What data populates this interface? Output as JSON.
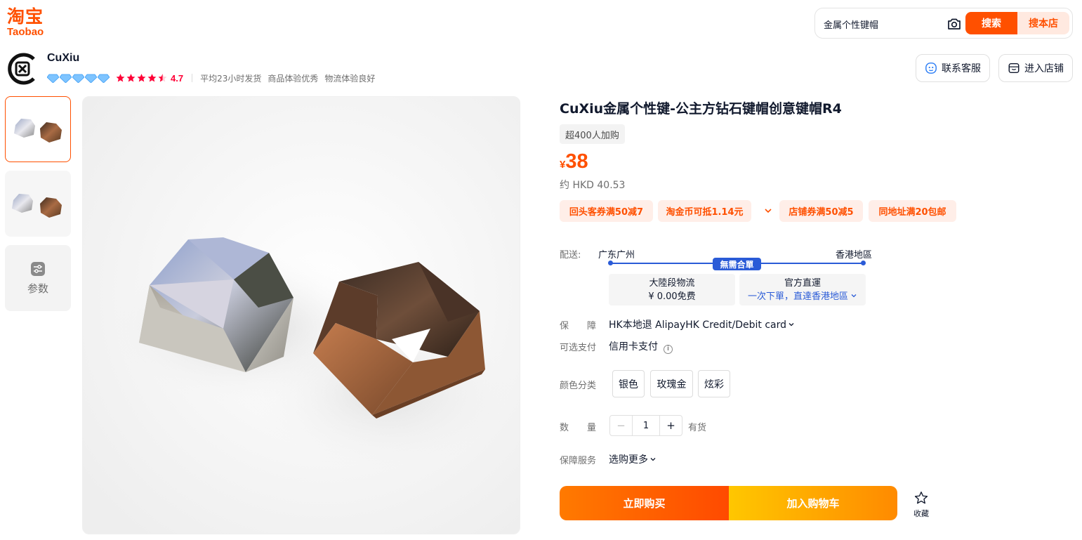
{
  "brand": {
    "logo_cn": "淘宝",
    "logo_en": "Taobao",
    "color": "#ff5000"
  },
  "search": {
    "query": "金属个性键帽",
    "search_label": "搜索",
    "store_search_label": "搜本店"
  },
  "shop": {
    "name": "CuXiu",
    "diamonds": 5,
    "stars": 4.7,
    "rating": "4.7",
    "tags": [
      "平均23小时发货",
      "商品体验优秀",
      "物流体验良好"
    ],
    "contact_label": "联系客服",
    "enter_store_label": "进入店铺"
  },
  "gallery": {
    "params_label": "参数",
    "thumbnails": 2
  },
  "product": {
    "title": "CuXiu金属个性键-公主方钻石键帽创意键帽R4",
    "sold": "超400人加购",
    "currency": "¥",
    "price": "38",
    "hkd": "约 HKD 40.53",
    "coupons": [
      "回头客券满50减7",
      "淘金币可抵1.14元",
      "店铺券满50减5",
      "同地址满20包邮"
    ]
  },
  "shipping": {
    "label": "配送:",
    "from": "广东广州",
    "to": "香港地區",
    "badge": "無需合單",
    "leg1_title": "大陸段物流",
    "leg1_value": "¥ 0.00免费",
    "leg2_title": "官方直運",
    "leg2_value": "一次下單，直達香港地區",
    "link_color": "#2a5bd7"
  },
  "guarantee": {
    "label": "保　　障",
    "value": "HK本地退 AlipayHK Credit/Debit card"
  },
  "payment": {
    "label": "可选支付",
    "value": "信用卡支付"
  },
  "color": {
    "label": "颜色分类",
    "options": [
      "银色",
      "玫瑰金",
      "炫彩"
    ]
  },
  "quantity": {
    "label": "数　　量",
    "value": "1",
    "minus": "−",
    "plus": "+",
    "stock": "有货"
  },
  "service": {
    "label": "保障服务",
    "value": "选购更多"
  },
  "actions": {
    "buy_now": "立即购买",
    "add_to_cart": "加入购物车",
    "favorite": "收藏"
  }
}
